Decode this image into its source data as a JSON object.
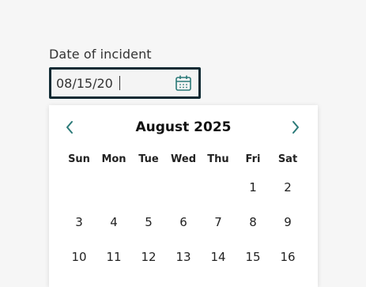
{
  "field": {
    "label": "Date of incident",
    "value": "08/15/20",
    "icon": "calendar-icon"
  },
  "calendar": {
    "month_title": "August 2025",
    "prev_icon": "chevron-left-icon",
    "next_icon": "chevron-right-icon",
    "weekdays": [
      "Sun",
      "Mon",
      "Tue",
      "Wed",
      "Thu",
      "Fri",
      "Sat"
    ],
    "weeks": [
      [
        "",
        "",
        "",
        "",
        "",
        "1",
        "2"
      ],
      [
        "3",
        "4",
        "5",
        "6",
        "7",
        "8",
        "9"
      ],
      [
        "10",
        "11",
        "12",
        "13",
        "14",
        "15",
        "16"
      ]
    ]
  },
  "colors": {
    "accent": "#2b7a78",
    "input_border": "#0f2a33"
  }
}
